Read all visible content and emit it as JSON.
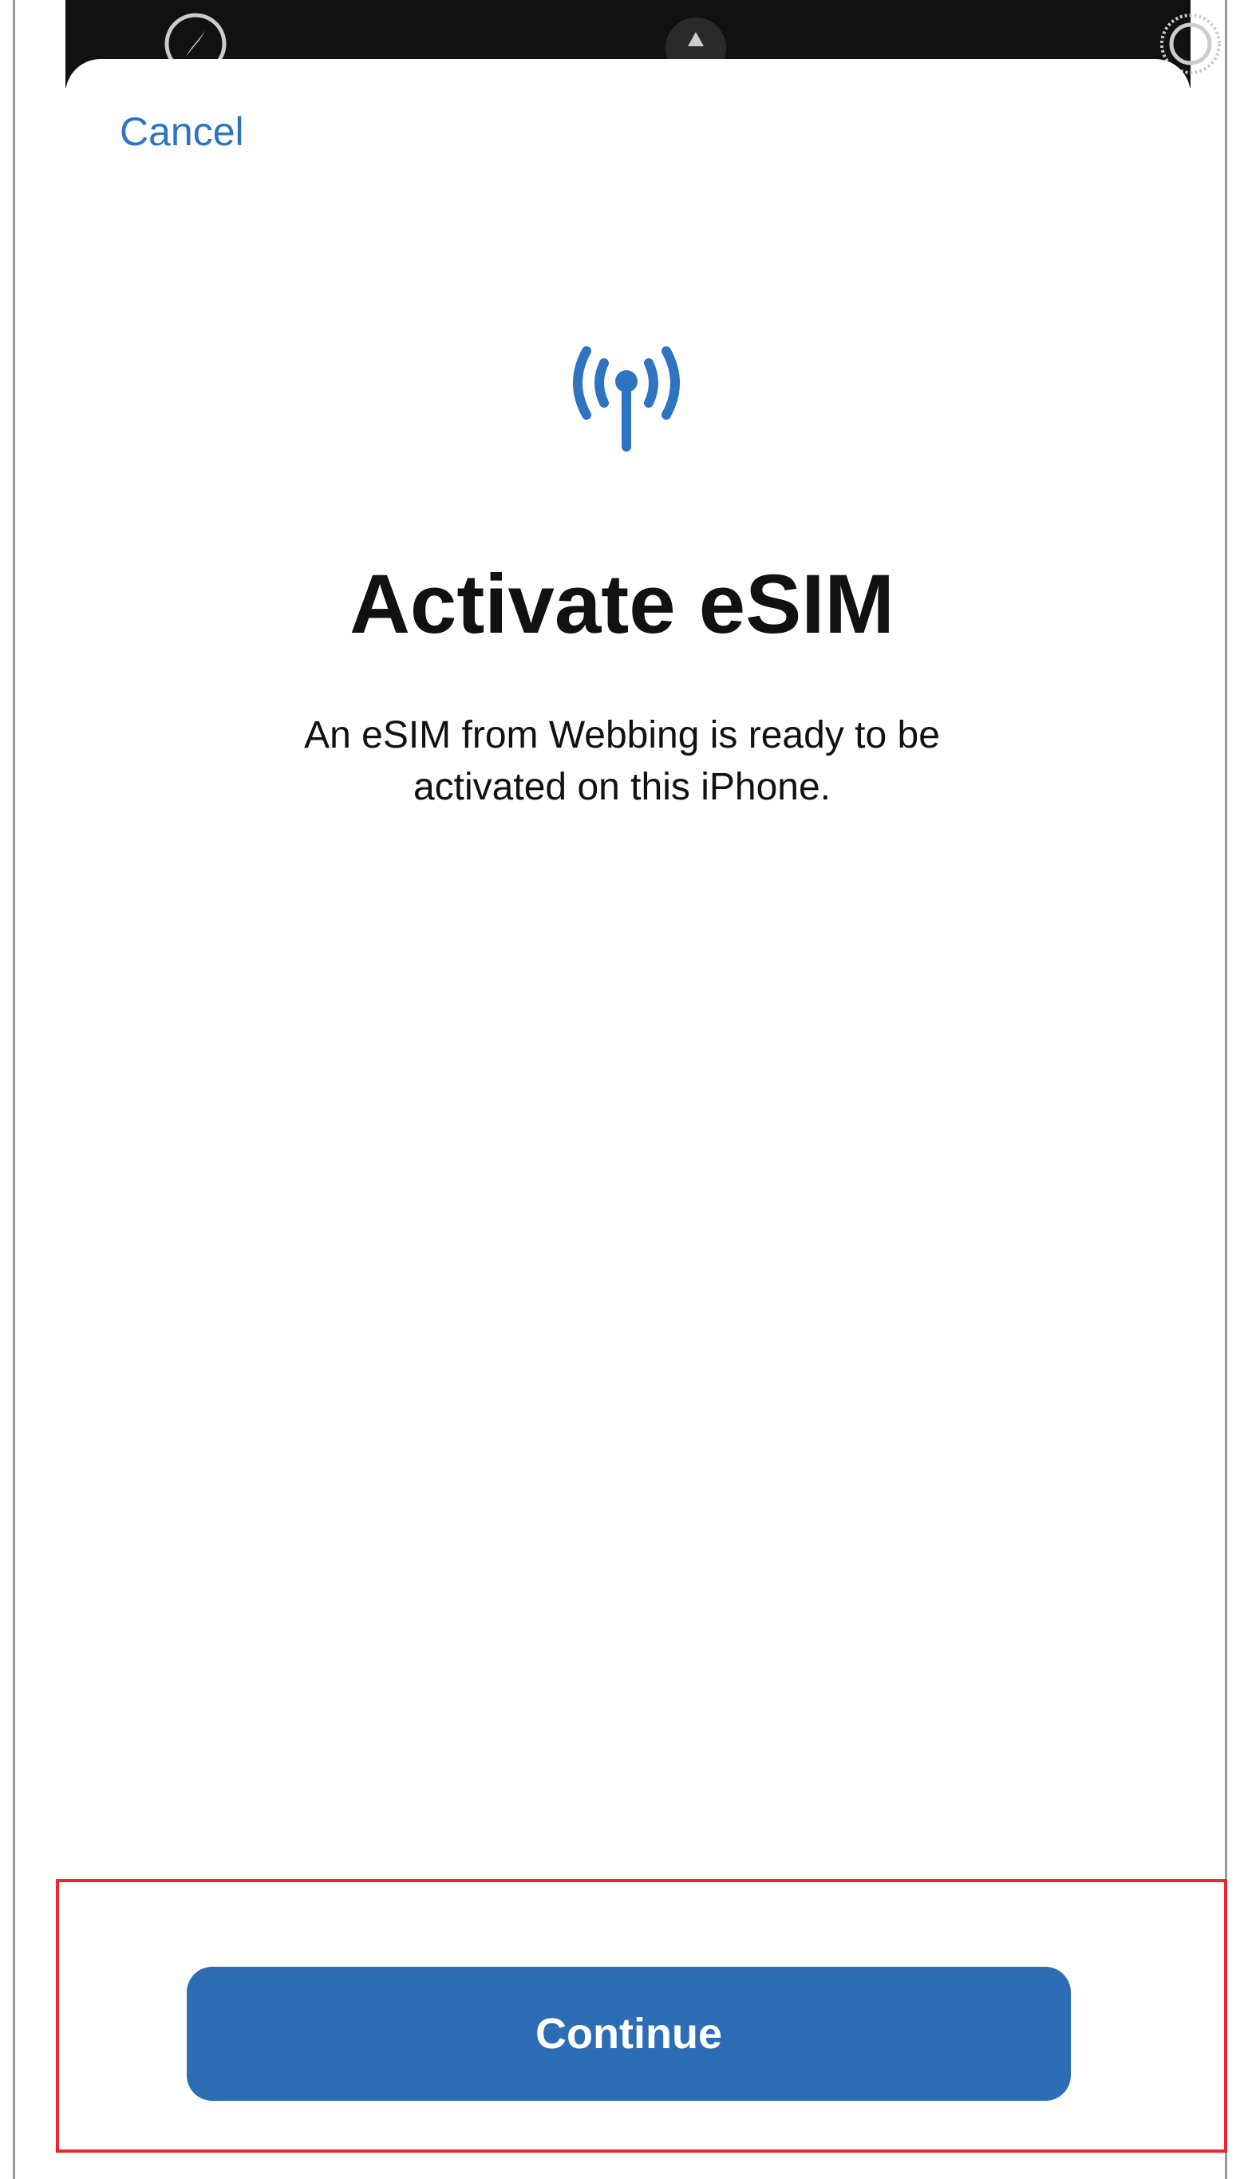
{
  "header": {
    "cancel_label": "Cancel"
  },
  "main": {
    "icon": "antenna-signal-icon",
    "title": "Activate eSIM",
    "description_line1": "An eSIM from Webbing is ready to be",
    "description_line2": "activated on this iPhone."
  },
  "footer": {
    "continue_label": "Continue"
  },
  "colors": {
    "accent": "#2f74c0",
    "button": "#2c6db6",
    "highlight": "#e8282b",
    "status_bar": "#111111"
  },
  "status_icons": [
    "compass-icon",
    "home-indicator-icon",
    "settings-icon"
  ]
}
